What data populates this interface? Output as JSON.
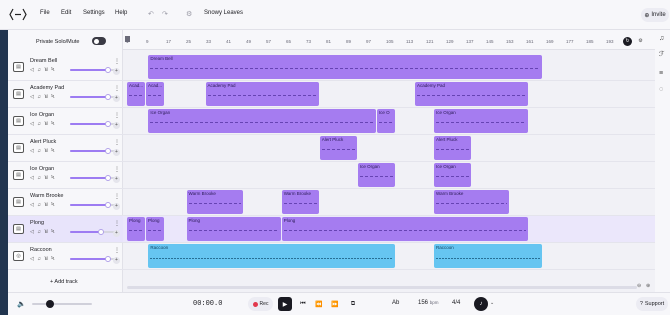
{
  "menubar": {
    "menu": [
      "File",
      "Edit",
      "Settings",
      "Help"
    ],
    "project_name": "Snowy Leaves",
    "invite_label": "Invite"
  },
  "trackpanel": {
    "solo_label": "Private Solo/Mute",
    "add_track_label": "+ Add track",
    "tracks": [
      {
        "name": "Dream Bell",
        "volume": 0.85
      },
      {
        "name": "Academy Pad",
        "volume": 0.85
      },
      {
        "name": "Ice Organ",
        "volume": 0.85
      },
      {
        "name": "Alert Pluck",
        "volume": 0.85
      },
      {
        "name": "Ice Organ",
        "volume": 0.85
      },
      {
        "name": "Warm Brooke",
        "volume": 0.85
      },
      {
        "name": "Plong",
        "volume": 0.7
      },
      {
        "name": "Raccoon",
        "volume": 0.85
      }
    ],
    "selected_track": 6
  },
  "ruler": {
    "bars": [
      "1",
      "9",
      "17",
      "25",
      "33",
      "41",
      "49",
      "57",
      "65",
      "73",
      "81",
      "89",
      "97",
      "105",
      "113",
      "121",
      "129",
      "137",
      "145",
      "153",
      "161",
      "169",
      "177",
      "185",
      "193"
    ]
  },
  "clips": [
    {
      "track": 0,
      "title": "Dream Bell",
      "color": "purple",
      "start": 9,
      "end": 175
    },
    {
      "track": 1,
      "title": "Acad...",
      "color": "purple",
      "start": 0,
      "end": 8
    },
    {
      "track": 1,
      "title": "Acad...",
      "color": "purple",
      "start": 8,
      "end": 16
    },
    {
      "track": 1,
      "title": "Academy Pad",
      "color": "purple",
      "start": 33,
      "end": 81
    },
    {
      "track": 1,
      "title": "Academy Pad",
      "color": "purple",
      "start": 121,
      "end": 169
    },
    {
      "track": 2,
      "title": "Ice Organ",
      "color": "purple",
      "start": 9,
      "end": 105
    },
    {
      "track": 2,
      "title": "Ice O",
      "color": "purple",
      "start": 105,
      "end": 113
    },
    {
      "track": 2,
      "title": "Ice Organ",
      "color": "purple",
      "start": 129,
      "end": 169
    },
    {
      "track": 3,
      "title": "Alert Pluck",
      "color": "purple",
      "start": 81,
      "end": 97
    },
    {
      "track": 3,
      "title": "Alert Pluck",
      "color": "purple",
      "start": 129,
      "end": 145
    },
    {
      "track": 4,
      "title": "Ice Organ",
      "color": "purple",
      "start": 97,
      "end": 113
    },
    {
      "track": 4,
      "title": "Ice Organ",
      "color": "purple",
      "start": 129,
      "end": 145
    },
    {
      "track": 5,
      "title": "Warm Brooke",
      "color": "purple",
      "start": 25,
      "end": 49
    },
    {
      "track": 5,
      "title": "Warm Brooke",
      "color": "purple",
      "start": 65,
      "end": 81
    },
    {
      "track": 5,
      "title": "Warm Brooke",
      "color": "purple",
      "start": 129,
      "end": 161
    },
    {
      "track": 6,
      "title": "Plong",
      "color": "purple",
      "start": 0,
      "end": 8
    },
    {
      "track": 6,
      "title": "Plong",
      "color": "purple",
      "start": 8,
      "end": 16
    },
    {
      "track": 6,
      "title": "Plong",
      "color": "purple",
      "start": 25,
      "end": 65
    },
    {
      "track": 6,
      "title": "Plong",
      "color": "purple",
      "start": 65,
      "end": 169
    },
    {
      "track": 7,
      "title": "Raccoon",
      "color": "blue",
      "start": 9,
      "end": 113
    },
    {
      "track": 7,
      "title": "Raccoon",
      "color": "blue",
      "start": 129,
      "end": 175
    }
  ],
  "transport": {
    "timecode": "00:00.0",
    "rec_label": "Rec",
    "key": "Ab",
    "bpm_value": "156",
    "bpm_unit": "bpm",
    "time_signature": "4/4",
    "support_label": "Support",
    "master_volume": 0.3
  },
  "colors": {
    "clip_purple": "#a57cf0",
    "clip_blue": "#66c5f1",
    "accent": "#9d7cf2",
    "record": "#e2384d"
  }
}
